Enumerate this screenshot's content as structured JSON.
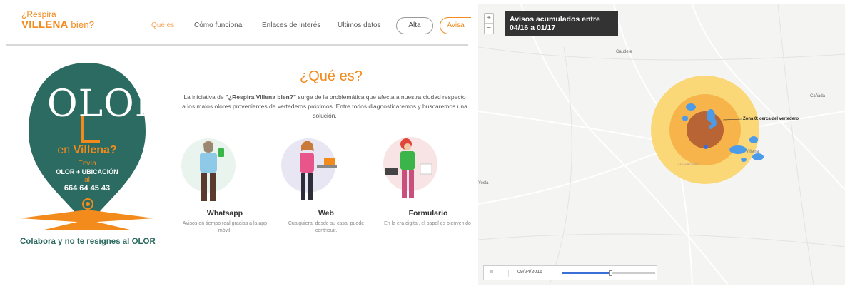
{
  "left": {
    "logo_line1": "¿Respira",
    "logo_line2": "VILLENA",
    "logo_line3": "bien?",
    "nav": [
      {
        "label": "Qué es"
      },
      {
        "label": "Cómo funciona"
      },
      {
        "label": "Enlaces de interés"
      },
      {
        "label": "Últimos datos"
      },
      {
        "label": "Alta"
      },
      {
        "label": "Avisa"
      }
    ],
    "poster": {
      "olor": "OLOR",
      "en": "en",
      "villena": "Villena?",
      "envia": "Envía",
      "olor_ubicacion": "OLOR + UBICACIÓN",
      "al": "al",
      "phone": "664 64 45 43",
      "colabora": "Colabora y no te resignes al OLOR"
    },
    "section_title": "¿Qué es?",
    "intro_prefix": "La iniciativa de ",
    "intro_bold": "\"¿Respira Villena bien?\"",
    "intro_rest": " surge de la problemática que afecta a nuestra ciudad respecto a los malos olores provenientes de vertederos próximos. Entre todos diagnosticaremos y buscaremos una solución.",
    "features": [
      {
        "title": "Whatsapp",
        "desc": "Avisos en tiempo real gracias a la app móvil."
      },
      {
        "title": "Web",
        "desc": "Cualquiera, desde su casa, puede contribuir."
      },
      {
        "title": "Formulario",
        "desc": "En la era digital, el papel es bienvenido."
      }
    ]
  },
  "map": {
    "zoom_in": "+",
    "zoom_out": "−",
    "title_line1": "Avisos acumulados entre",
    "title_line2": "04/16 a 01/17",
    "towns": {
      "caudete": "Caudete",
      "canada": "Cañada",
      "yecla": "Yecla",
      "villena": "Villena",
      "virtudes": "LAS VIRTUDES"
    },
    "zone_label": "Zona 0: cerca del vertedero",
    "player": {
      "pause": "II",
      "date": "09/24/2016",
      "progress": 0.52
    }
  }
}
